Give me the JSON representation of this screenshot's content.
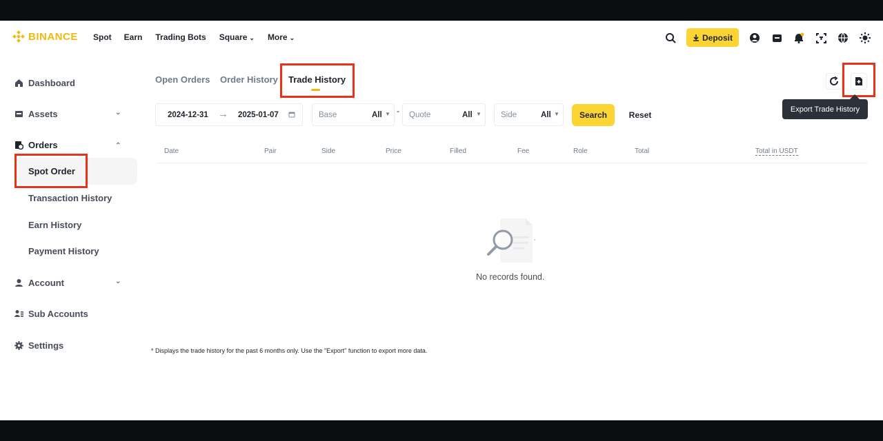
{
  "header": {
    "logo_text": "BINANCE",
    "nav": [
      {
        "label": "Spot"
      },
      {
        "label": "Earn"
      },
      {
        "label": "Trading Bots"
      },
      {
        "label": "Square"
      },
      {
        "label": "More"
      }
    ],
    "deposit_label": "Deposit"
  },
  "sidebar": {
    "items": [
      {
        "label": "Dashboard",
        "icon": "home-icon"
      },
      {
        "label": "Assets",
        "icon": "wallet-icon"
      },
      {
        "label": "Orders",
        "icon": "orders-icon"
      },
      {
        "label": "Account",
        "icon": "user-icon"
      },
      {
        "label": "Sub Accounts",
        "icon": "sub-accounts-icon"
      },
      {
        "label": "Settings",
        "icon": "gear-icon"
      }
    ],
    "orders_sub": [
      {
        "label": "Spot Order"
      },
      {
        "label": "Transaction History"
      },
      {
        "label": "Earn History"
      },
      {
        "label": "Payment History"
      }
    ]
  },
  "main": {
    "tabs": [
      {
        "label": "Open Orders"
      },
      {
        "label": "Order History"
      },
      {
        "label": "Trade History"
      }
    ],
    "filters": {
      "start_date": "2024-12-31",
      "end_date": "2025-01-07",
      "base_label": "Base",
      "base_value": "All",
      "quote_placeholder": "Quote",
      "quote_value": "All",
      "side_label": "Side",
      "side_value": "All",
      "search_label": "Search",
      "reset_label": "Reset"
    },
    "table": {
      "columns": [
        "Date",
        "Pair",
        "Side",
        "Price",
        "Filled",
        "Fee",
        "Role",
        "Total",
        "Total in USDT"
      ]
    },
    "empty_text": "No records found.",
    "footnote": "* Displays the trade history for the past 6 months only. Use the \"Export\" function to export more data.",
    "tooltip": "Export Trade History"
  },
  "colors": {
    "brand": "#f0b90b",
    "button_yellow": "#fcd535",
    "highlight_red": "#e8321a"
  }
}
